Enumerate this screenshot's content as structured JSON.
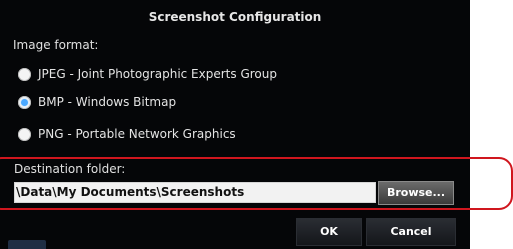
{
  "dialog": {
    "title": "Screenshot Configuration",
    "image_format_label": "Image format:",
    "options": [
      {
        "label": "JPEG - Joint Photographic Experts Group",
        "selected": false
      },
      {
        "label": "BMP - Windows Bitmap",
        "selected": true
      },
      {
        "label": "PNG - Portable Network Graphics",
        "selected": false
      }
    ],
    "destination_label": "Destination folder:",
    "destination_value": "\\Data\\My Documents\\Screenshots",
    "browse_label": "Browse...",
    "ok_label": "OK",
    "cancel_label": "Cancel"
  },
  "colors": {
    "dialog_background": "#050608",
    "radio_selected": "#4aa8ff",
    "highlight": "#d0161e"
  }
}
